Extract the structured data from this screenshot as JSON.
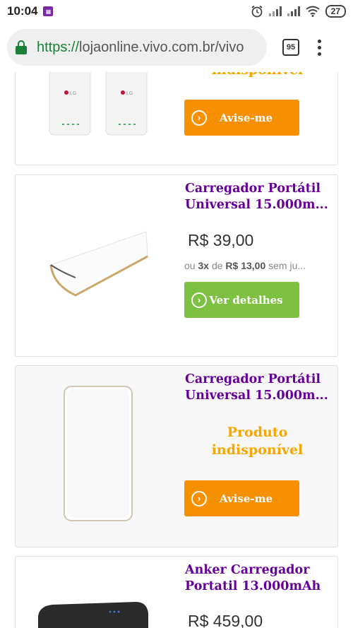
{
  "status_bar": {
    "time": "10:04",
    "battery": "27"
  },
  "browser": {
    "url_scheme": "https://",
    "url_rest": "lojaonline.vivo.com.br/vivo",
    "tab_count": "95"
  },
  "products": [
    {
      "title": "",
      "unavailable_text": "indisponível",
      "button_label": "Avise-me",
      "image": "lg-power-bank-pair-image"
    },
    {
      "title": "Carregador Portátil Universal 15.000m...",
      "price": "R$ 39,00",
      "installments": {
        "prefix": "ou",
        "count": "3x",
        "de": "de",
        "amount": "R$ 13,00",
        "suffix": "sem ju..."
      },
      "button_label": "Ver detalhes",
      "image": "slim-power-bank-image"
    },
    {
      "title": "Carregador Portátil Universal 15.000m...",
      "unavailable_text": "Produto indisponível",
      "button_label": "Avise-me",
      "image": "white-power-bank-image"
    },
    {
      "title": "Anker Carregador Portatil 13.000mAh",
      "price": "R$ 459,00",
      "image": "anker-power-bank-image"
    }
  ],
  "colors": {
    "brand_purple": "#660099",
    "orange": "#f79000",
    "green": "#7ec142",
    "url_green": "#188038"
  }
}
